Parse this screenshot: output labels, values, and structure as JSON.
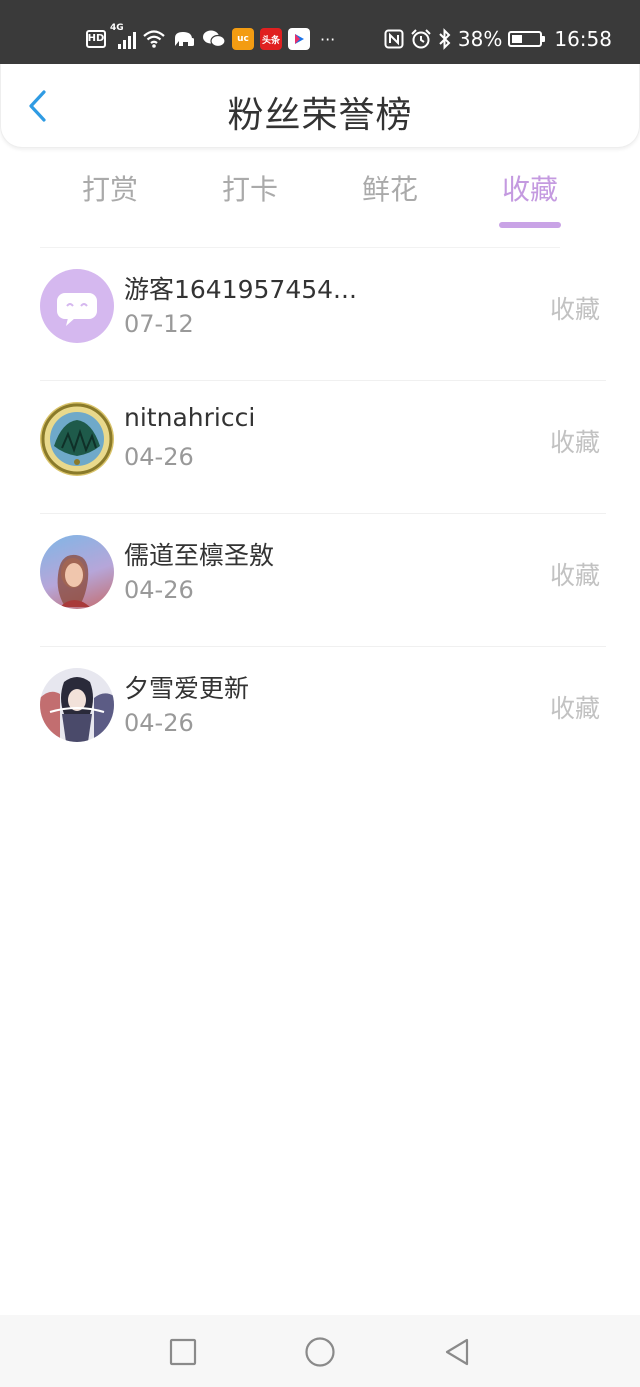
{
  "status_bar": {
    "network_badge": "HD",
    "signal_label": "4G",
    "app_badge_uc": "uc",
    "app_badge_toutiao": "头条",
    "app_badge_youku": "YOUKU",
    "more": "···",
    "battery_percent": "38%",
    "time": "16:58",
    "icons": [
      "hd-icon",
      "signal-icon",
      "wifi-icon",
      "elephant-icon",
      "wechat-icon",
      "uc-browser-icon",
      "toutiao-icon",
      "youku-icon",
      "more-icon",
      "nfc-icon",
      "alarm-icon",
      "bluetooth-icon",
      "battery-icon"
    ]
  },
  "header": {
    "title": "粉丝荣誉榜",
    "back_icon": "chevron-left-icon",
    "back_color": "#2f9be3"
  },
  "tabs": [
    {
      "label": "打赏",
      "active": false
    },
    {
      "label": "打卡",
      "active": false
    },
    {
      "label": "鲜花",
      "active": false
    },
    {
      "label": "收藏",
      "active": true
    }
  ],
  "colors": {
    "accent": "#c49ae0",
    "tab_inactive": "#aaaaaa",
    "name_text": "#333333",
    "date_text": "#999999",
    "action_text": "#c2c2c2"
  },
  "fans": [
    {
      "name": "游客1641957454...",
      "date": "07-12",
      "action": "收藏",
      "avatar": "guest-avatar"
    },
    {
      "name": "nitnahricci",
      "date": "04-26",
      "action": "收藏",
      "avatar": "emblem-avatar"
    },
    {
      "name": "儒道至檩圣敫",
      "date": "04-26",
      "action": "收藏",
      "avatar": "portrait-avatar"
    },
    {
      "name": "夕雪爱更新",
      "date": "04-26",
      "action": "收藏",
      "avatar": "anime-avatar"
    }
  ],
  "nav_bar": {
    "recent_icon": "square-icon",
    "home_icon": "circle-icon",
    "back_icon": "triangle-back-icon"
  }
}
